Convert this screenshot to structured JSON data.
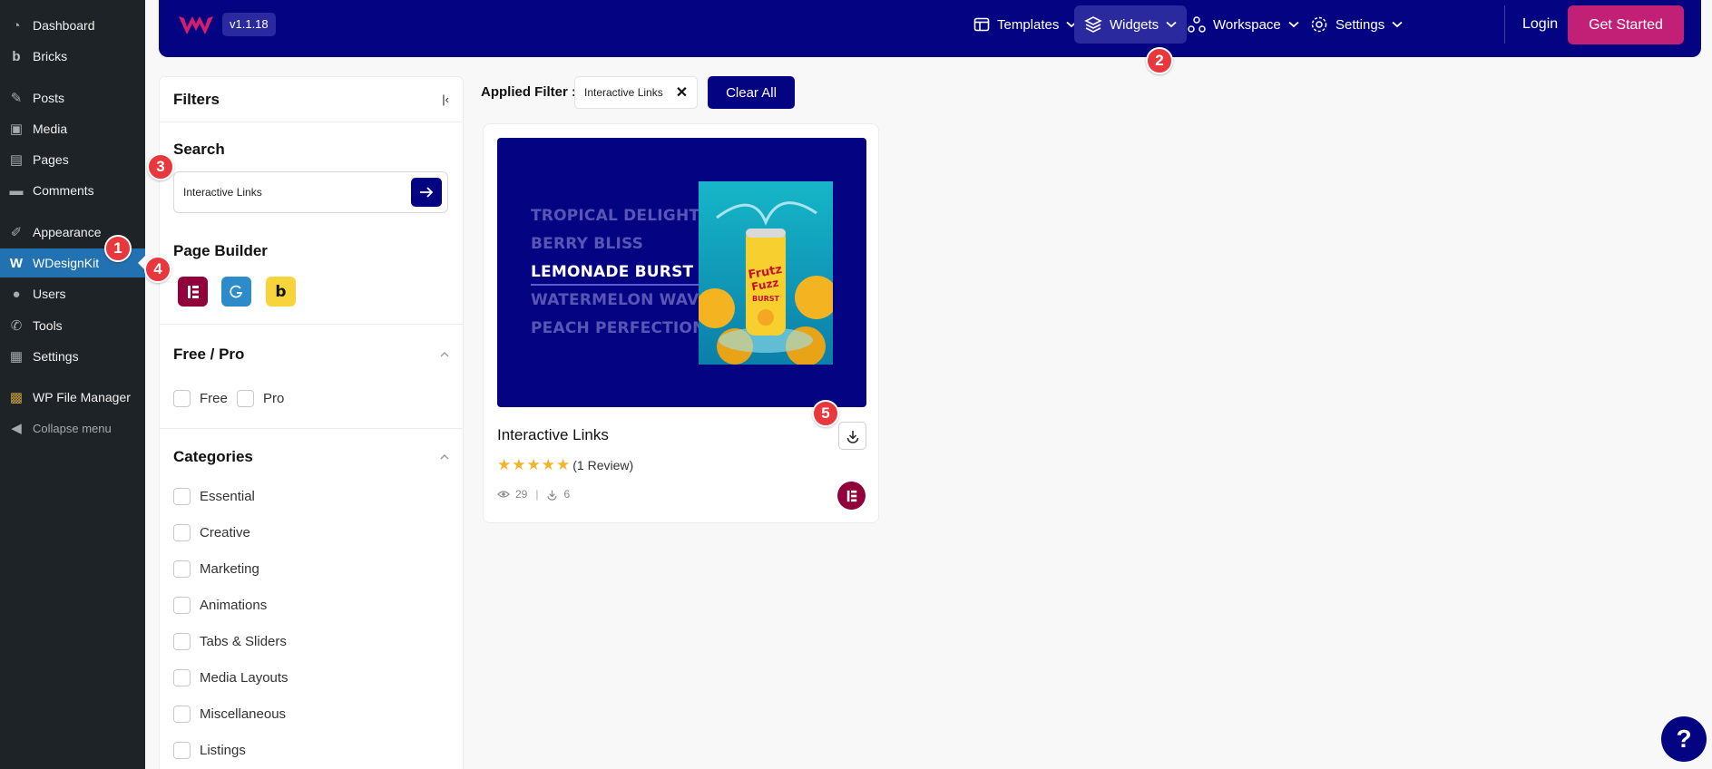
{
  "wp_menu": {
    "items": [
      {
        "label": "Dashboard",
        "icon": "dashboard-icon",
        "glyph": "◔"
      },
      {
        "label": "Bricks",
        "icon": "bricks-icon",
        "glyph": "b"
      },
      {
        "label": "Posts",
        "icon": "pin-icon",
        "glyph": "✎"
      },
      {
        "label": "Media",
        "icon": "media-icon",
        "glyph": "▣"
      },
      {
        "label": "Pages",
        "icon": "pages-icon",
        "glyph": "▤"
      },
      {
        "label": "Comments",
        "icon": "comment-icon",
        "glyph": "▬"
      },
      {
        "label": "Appearance",
        "icon": "brush-icon",
        "glyph": "✐"
      },
      {
        "label": "WDesignKit",
        "icon": "wdesignkit-icon",
        "glyph": "W"
      },
      {
        "label": "Users",
        "icon": "users-icon",
        "glyph": "●"
      },
      {
        "label": "Tools",
        "icon": "wrench-icon",
        "glyph": "✆"
      },
      {
        "label": "Settings",
        "icon": "settings-icon",
        "glyph": "▦"
      },
      {
        "label": "WP File Manager",
        "icon": "file-manager-icon",
        "glyph": "▩"
      }
    ],
    "collapse_label": "Collapse menu",
    "active_item": "WDesignKit"
  },
  "topbar": {
    "version": "v1.1.18",
    "nav": {
      "templates": "Templates",
      "widgets": "Widgets",
      "workspace": "Workspace",
      "settings": "Settings"
    },
    "login": "Login",
    "get_started": "Get Started"
  },
  "filters": {
    "title": "Filters",
    "search": {
      "title": "Search",
      "value": "Interactive Links"
    },
    "page_builder": {
      "title": "Page Builder",
      "builders": [
        "elementor",
        "gutenberg",
        "bricks"
      ]
    },
    "free_pro": {
      "title": "Free / Pro",
      "options": [
        "Free",
        "Pro"
      ]
    },
    "categories": {
      "title": "Categories",
      "options": [
        "Essential",
        "Creative",
        "Marketing",
        "Animations",
        "Tabs & Sliders",
        "Media Layouts",
        "Miscellaneous",
        "Listings"
      ]
    }
  },
  "applied_filter": {
    "label": "Applied Filter :",
    "chip": "Interactive Links",
    "clear_all": "Clear All"
  },
  "widget_card": {
    "title": "Interactive Links",
    "preview_links": [
      "TROPICAL DELIGHT",
      "BERRY BLISS",
      "LEMONADE BURST",
      "WATERMELON WAVE",
      "PEACH PERFECTION"
    ],
    "highlighted_link": "LEMONADE BURST",
    "rating": 5,
    "review_text": "(1 Review)",
    "views": "29",
    "downloads": "6"
  },
  "markers": [
    "1",
    "2",
    "3",
    "4",
    "5"
  ],
  "help_label": "?",
  "colors": {
    "brand_navy": "#040483",
    "accent_pink": "#c22076",
    "wp_sidebar": "#1d2327",
    "wp_active": "#2271b1",
    "marker_red": "#e8373d",
    "star": "#f5b32a"
  }
}
